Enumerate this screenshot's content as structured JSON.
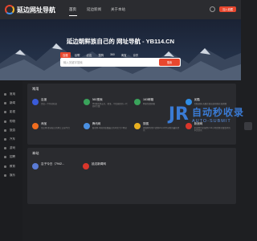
{
  "header": {
    "logo_text": "延边网址导航",
    "logo_sub": "YANBIAN WEBSITE NAVIGATION",
    "nav": [
      "首页",
      "延边新闻",
      "关于本站"
    ],
    "fav_label": "加入收藏"
  },
  "hero": {
    "title": "延边朝鲜族自己的 网址导航 - YB114.CN",
    "tabs": [
      "百度",
      "谷歌",
      "必应",
      "搜狗",
      "360",
      "淘宝",
      "京东"
    ],
    "search_placeholder": "输入关键字搜索",
    "search_button": "搜索"
  },
  "sidebar": {
    "items": [
      "常用",
      "新闻",
      "影视",
      "购物",
      "旅游",
      "汽车",
      "游戏",
      "招聘",
      "教育",
      "娱乐"
    ]
  },
  "sections": {
    "common": {
      "title": "常用",
      "cards": [
        {
          "name": "百度",
          "desc": "百度一下你就知道",
          "color": "#3a5bd9"
        },
        {
          "name": "360搜索",
          "desc": "360搜索是安全、精准、可信赖的新一代搜索引擎",
          "color": "#3aa35b"
        },
        {
          "name": "163邮箱",
          "desc": "网易免费邮箱",
          "color": "#3aa35b"
        },
        {
          "name": "优酷",
          "desc": "优酷视频-海量正版高清视频在线观看",
          "color": "#2f8de4"
        },
        {
          "name": "淘宝",
          "desc": "淘宝网-亚洲较大的网上交易平台",
          "color": "#f06d1f"
        },
        {
          "name": "腾讯网",
          "desc": "腾讯网-中国浏览量最大的中文门户网站",
          "color": "#4a90e2"
        },
        {
          "name": "搜狐",
          "desc": "搜狐网为用户提供24小时不间断的最新资讯",
          "color": "#e8b020"
        },
        {
          "name": "新浪网",
          "desc": "新浪网为全球用户24小时提供全面及时的中文资讯",
          "color": "#d9362b"
        }
      ]
    },
    "recommend": {
      "title": "本站",
      "cards": [
        {
          "name": "吉子今日（7942...",
          "desc": "",
          "color": "#5a7bd5"
        },
        {
          "name": "延边新闻网",
          "desc": "",
          "color": "#d9362b"
        }
      ]
    }
  },
  "watermark": {
    "mark": "JR",
    "title": "自动秒收录",
    "sub": "AUTO-SUBMIT"
  }
}
